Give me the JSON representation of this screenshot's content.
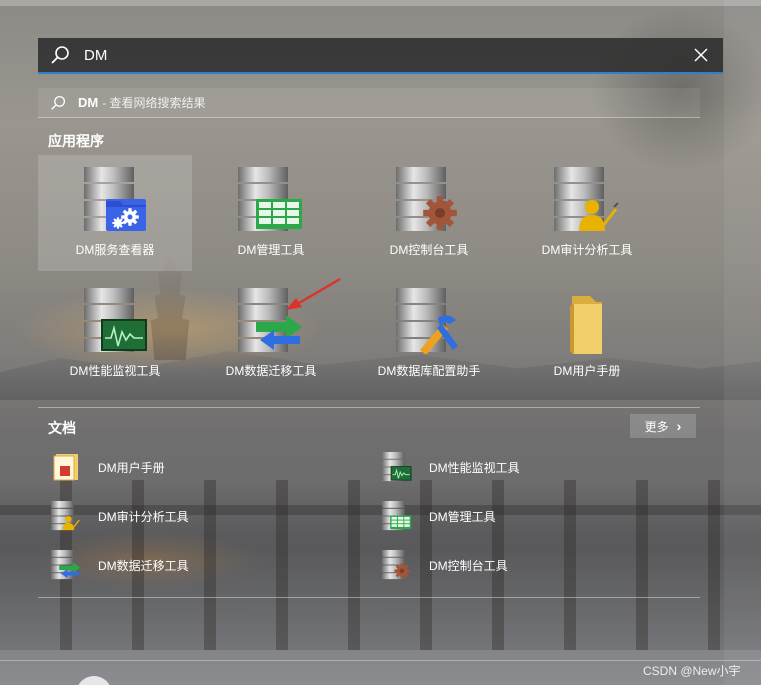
{
  "search": {
    "query": "DM"
  },
  "web_search": {
    "query": "DM",
    "hint": "- 查看网络搜索结果"
  },
  "apps_section": {
    "title": "应用程序",
    "items": [
      {
        "label": "DM服务查看器",
        "icon": "dm-service-viewer-icon",
        "selected": true
      },
      {
        "label": "DM管理工具",
        "icon": "dm-manager-icon"
      },
      {
        "label": "DM控制台工具",
        "icon": "dm-console-icon"
      },
      {
        "label": "DM审计分析工具",
        "icon": "dm-audit-icon"
      },
      {
        "label": "DM性能监视工具",
        "icon": "dm-monitor-icon"
      },
      {
        "label": "DM数据迁移工具",
        "icon": "dm-migration-icon",
        "annotated_with": "red-arrow"
      },
      {
        "label": "DM数据库配置助手",
        "icon": "dm-config-assistant-icon"
      },
      {
        "label": "DM用户手册",
        "icon": "folder-icon"
      }
    ]
  },
  "docs_section": {
    "title": "文档",
    "more_label": "更多",
    "items": [
      {
        "label": "DM用户手册",
        "icon": "pdf-doc-icon"
      },
      {
        "label": "DM性能监视工具",
        "icon": "dm-monitor-icon"
      },
      {
        "label": "DM审计分析工具",
        "icon": "dm-audit-icon"
      },
      {
        "label": "DM管理工具",
        "icon": "dm-manager-icon"
      },
      {
        "label": "DM数据迁移工具",
        "icon": "dm-migration-icon"
      },
      {
        "label": "DM控制台工具",
        "icon": "dm-console-icon"
      }
    ]
  },
  "watermark": "CSDN @New小宇",
  "colors": {
    "accent": "#2f7fd1",
    "arrow_annotation": "#e0302a",
    "gear_blue": "#2f6ee0",
    "grid_green": "#2aa84a",
    "gear_brown": "#a3553a",
    "user_yellow": "#e8b200",
    "folder_yellow": "#f2cf6a"
  }
}
